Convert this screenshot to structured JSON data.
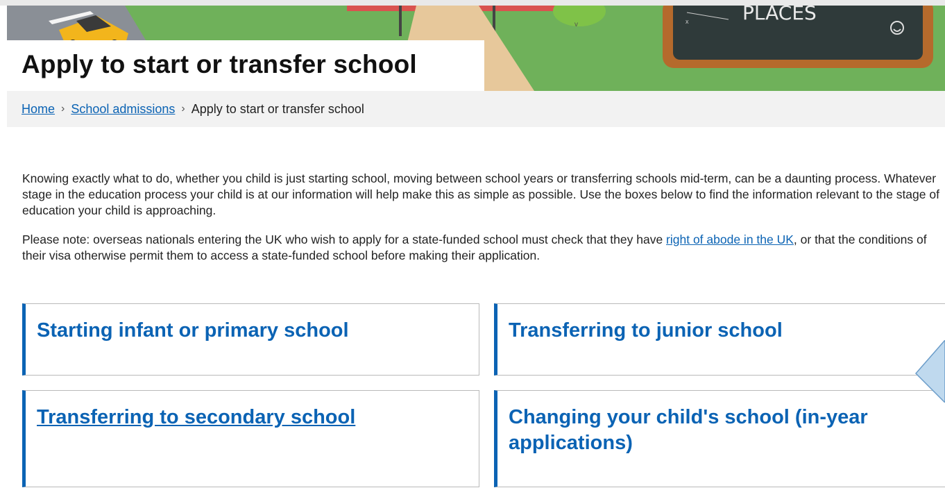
{
  "page": {
    "title": "Apply to start or transfer school"
  },
  "breadcrumb": {
    "items": [
      {
        "label": "Home",
        "link": true
      },
      {
        "label": "School admissions",
        "link": true
      },
      {
        "label": "Apply to start or transfer school",
        "link": false
      }
    ],
    "separator": ">"
  },
  "intro": {
    "paragraph1": "Knowing exactly what to do, whether you child is just starting school, moving between school years or transferring schools mid-term, can be a daunting process. Whatever stage in the education process your child is at our information will help make this as simple as possible. Use the boxes below to find the information relevant to the stage of education your child is approaching.",
    "paragraph2_before": "Please note: overseas nationals entering the UK who wish to apply for a state-funded school must check that they have ",
    "paragraph2_link": "right of abode in the UK",
    "paragraph2_after": ", or that the conditions of their visa otherwise permit them to access a state-funded school before making their application."
  },
  "cards": [
    {
      "title": "Starting infant or primary school"
    },
    {
      "title": "Transferring to junior school"
    },
    {
      "title": "Transferring to secondary school"
    },
    {
      "title": "Changing your child's school (in-year applications)"
    }
  ],
  "colors": {
    "link": "#0b63b4",
    "card_accent": "#0b63b4",
    "breadcrumb_bg": "#f2f2f2",
    "hero_grass": "#6fb15a"
  },
  "icons": {
    "breadcrumb_separator": "chevron-right-icon",
    "chat_tab": "chat-arrow-icon"
  }
}
